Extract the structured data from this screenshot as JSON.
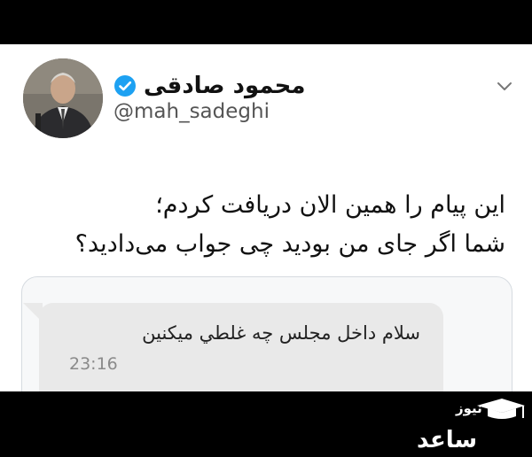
{
  "profile": {
    "display_name": "محمود صادقی",
    "handle": "@mah_sadeghi",
    "verified_icon": "verified-badge-icon",
    "accent_color": "#1da1f2"
  },
  "tweet": {
    "lines": [
      "این پیام را همین الان دریافت کردم؛",
      "شما اگر جای من بودید چی جواب می‌دادید؟"
    ]
  },
  "quoted_message": {
    "text": "سلام داخل مجلس چه غلطي ميكنين",
    "time": "23:16"
  },
  "watermark": {
    "top": "نیوز",
    "main": "ساعد"
  },
  "menu_icon": "chevron-down-icon"
}
